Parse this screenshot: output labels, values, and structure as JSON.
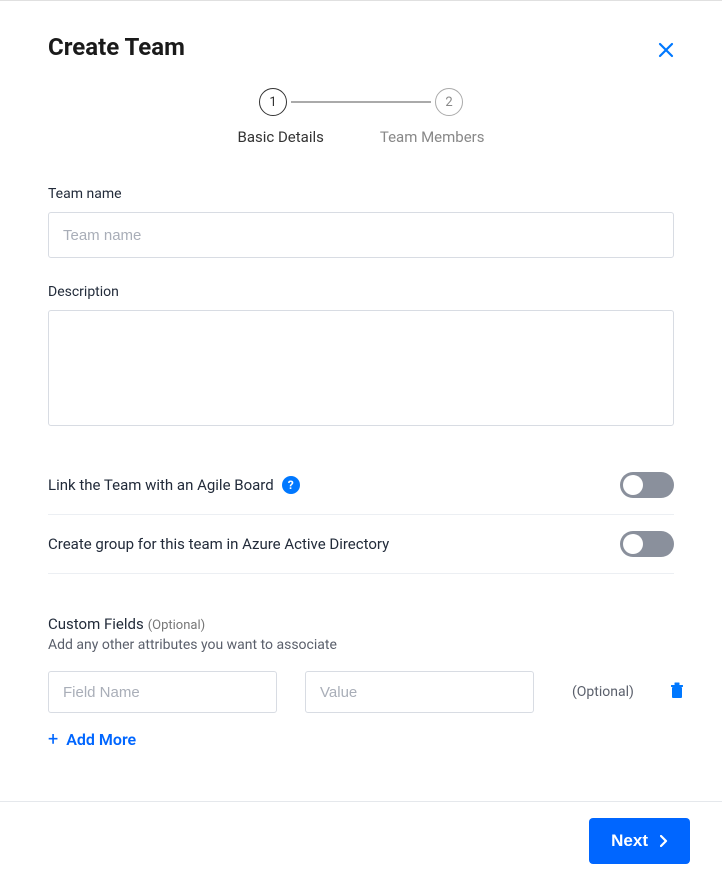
{
  "header": {
    "title": "Create Team"
  },
  "stepper": {
    "step1_num": "1",
    "step2_num": "2",
    "step1_label": "Basic Details",
    "step2_label": "Team Members"
  },
  "form": {
    "team_name": {
      "label": "Team name",
      "placeholder": "Team name",
      "value": ""
    },
    "description": {
      "label": "Description",
      "value": ""
    },
    "link_agile": {
      "label": "Link the Team with an Agile Board",
      "help": "?",
      "value": false
    },
    "azure_ad": {
      "label": "Create group for this team in Azure Active Directory",
      "value": false
    },
    "custom_fields": {
      "title": "Custom Fields",
      "optional": "(Optional)",
      "subtitle": "Add any other attributes you want to associate",
      "field_name_placeholder": "Field Name",
      "value_placeholder": "Value",
      "row_optional": "(Optional)",
      "add_more": "Add More"
    }
  },
  "footer": {
    "next": "Next"
  }
}
